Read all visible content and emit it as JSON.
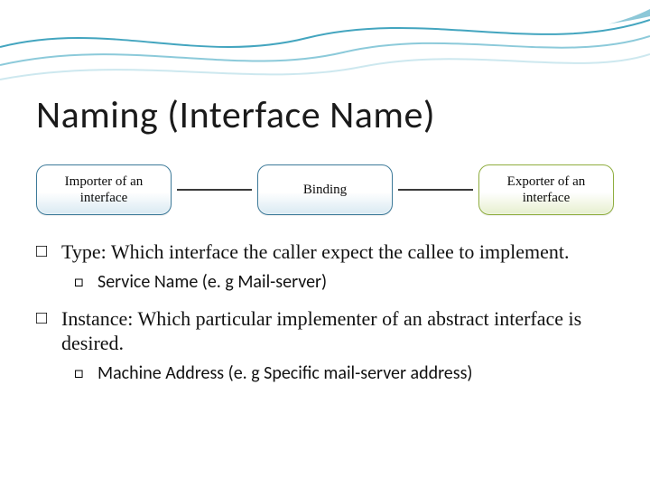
{
  "title": "Naming (Interface Name)",
  "diagram": {
    "left": "Importer of an interface",
    "mid": "Binding",
    "right": "Exporter of an interface"
  },
  "bullets": {
    "type_line": "Type: Which interface the caller expect the callee to implement.",
    "type_sub": "Service Name (e. g Mail-server)",
    "instance_line": "Instance: Which particular implementer of an abstract interface is desired.",
    "instance_sub": "Machine Address (e. g Specific mail-server address)"
  }
}
